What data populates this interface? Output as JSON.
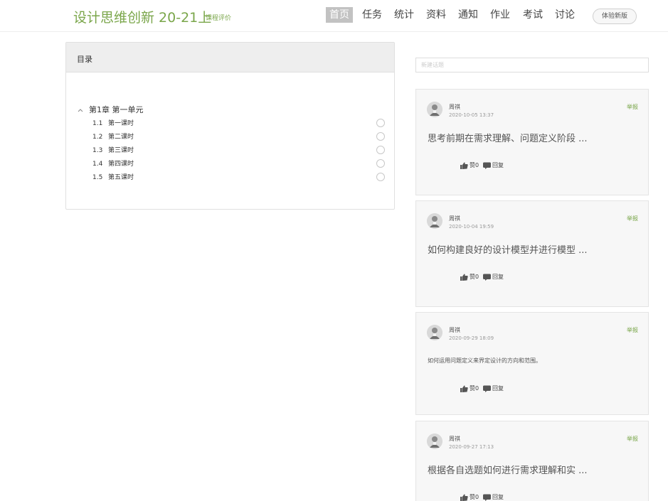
{
  "header": {
    "course_title": "设计思维创新 20-21上",
    "course_eval": "课程评价",
    "nav": [
      {
        "label": "首页",
        "active": true
      },
      {
        "label": "任务",
        "active": false
      },
      {
        "label": "统计",
        "active": false
      },
      {
        "label": "资料",
        "active": false
      },
      {
        "label": "通知",
        "active": false
      },
      {
        "label": "作业",
        "active": false
      },
      {
        "label": "考试",
        "active": false
      },
      {
        "label": "讨论",
        "active": false
      }
    ],
    "try_new": "体验新版"
  },
  "catalog": {
    "title": "目录",
    "chapter": {
      "caret_icon": "chevron-up-icon",
      "label": "第1章 第一单元",
      "lessons": [
        {
          "num": "1.1",
          "title": "第一课时"
        },
        {
          "num": "1.2",
          "title": "第二课时"
        },
        {
          "num": "1.3",
          "title": "第三课时"
        },
        {
          "num": "1.4",
          "title": "第四课时"
        },
        {
          "num": "1.5",
          "title": "第五课时"
        }
      ]
    }
  },
  "new_topic": {
    "placeholder": "新建话题"
  },
  "posts": [
    {
      "author": "周祺",
      "time": "2020-10-05 13:37",
      "title": "思考前期在需求理解、问题定义阶段 ...",
      "report": "举报",
      "likes": "赞0",
      "reply": "回复"
    },
    {
      "author": "周祺",
      "time": "2020-10-04 19:59",
      "title": "如何构建良好的设计模型并进行模型 ...",
      "report": "举报",
      "likes": "赞0",
      "reply": "回复"
    },
    {
      "author": "周祺",
      "time": "2020-09-29 18:09",
      "title": "如何运用问题定义来界定设计的方向和范围。",
      "report": "举报",
      "likes": "赞0",
      "reply": "回复"
    },
    {
      "author": "周祺",
      "time": "2020-09-27 17:13",
      "title": "根据各自选题如何进行需求理解和实 ...",
      "report": "举报",
      "likes": "赞0",
      "reply": "回复"
    }
  ],
  "colors": {
    "accent": "#7aa64a",
    "nav_active_bg": "#c2c2c2",
    "card_bg": "#f7f7f7"
  }
}
